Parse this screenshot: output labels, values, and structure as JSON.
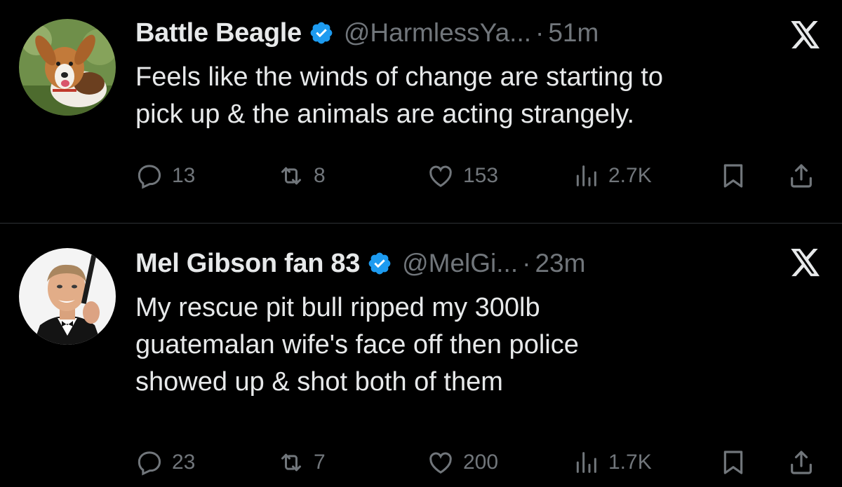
{
  "tweets": [
    {
      "name": "Battle Beagle",
      "handle": "@HarmlessYa...",
      "separator": "·",
      "time": "51m",
      "text_lines": [
        "Feels like the winds of change are starting to",
        "pick up & the animals are acting strangely."
      ],
      "replies": "13",
      "retweets": "8",
      "likes": "153",
      "views": "2.7K"
    },
    {
      "name": "Mel Gibson fan 83",
      "handle": "@MelGi...",
      "separator": "·",
      "time": "23m",
      "text_lines": [
        "My rescue pit bull ripped my 300lb",
        "guatemalan wife's face off then police",
        "showed up & shot both of them"
      ],
      "replies": "23",
      "retweets": "7",
      "likes": "200",
      "views": "1.7K"
    }
  ],
  "icons": {
    "verified": "verified-badge-icon",
    "x_logo": "x-logo-icon",
    "reply": "reply-icon",
    "retweet": "retweet-icon",
    "like": "heart-icon",
    "views": "views-icon",
    "bookmark": "bookmark-icon",
    "share": "share-icon"
  },
  "colors": {
    "background": "#000000",
    "text": "#e7e9ea",
    "secondary": "#71767b",
    "verified": "#1d9bf0",
    "divider": "#2f3336"
  }
}
